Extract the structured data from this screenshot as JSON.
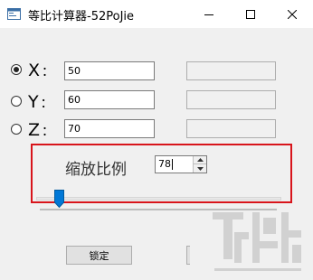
{
  "window": {
    "title": "等比计算器-52PoJie"
  },
  "axes": [
    {
      "key": "x",
      "label": "X",
      "colon": "：",
      "value": "50",
      "checked": true
    },
    {
      "key": "y",
      "label": "Y",
      "colon": "：",
      "value": "60",
      "checked": false
    },
    {
      "key": "z",
      "label": "Z",
      "colon": "：",
      "value": "70",
      "checked": false
    }
  ],
  "scale": {
    "label": "缩放比例",
    "value": "78",
    "slider_fraction": 0.08
  },
  "buttons": {
    "ok_label": "锁定"
  },
  "colors": {
    "highlight_border": "#d8141b",
    "slider_thumb": "#0078d7"
  }
}
